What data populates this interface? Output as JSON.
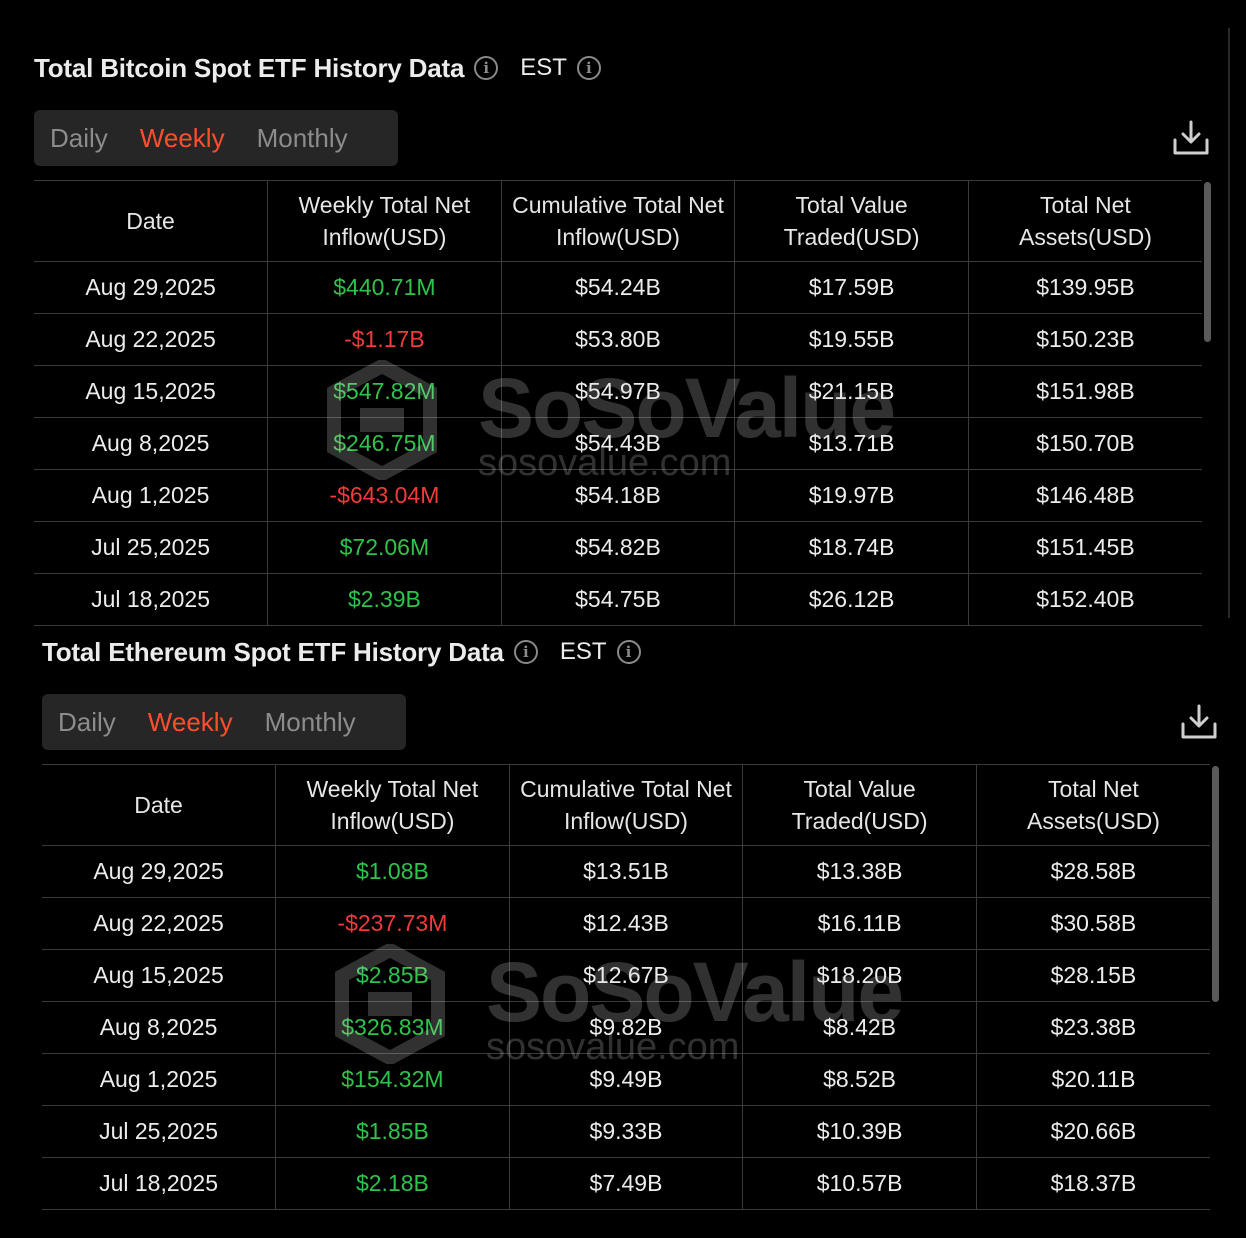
{
  "bitcoin": {
    "title": "Total Bitcoin Spot ETF History Data",
    "timezone": "EST",
    "tabs": [
      "Daily",
      "Weekly",
      "Monthly"
    ],
    "active_tab": "Weekly",
    "headers": [
      "Date",
      "Weekly Total Net Inflow(USD)",
      "Cumulative Total Net Inflow(USD)",
      "Total Value Traded(USD)",
      "Total Net Assets(USD)"
    ],
    "rows": [
      [
        "Aug 29,2025",
        "$440.71M",
        "$54.24B",
        "$17.59B",
        "$139.95B"
      ],
      [
        "Aug 22,2025",
        "-$1.17B",
        "$53.80B",
        "$19.55B",
        "$150.23B"
      ],
      [
        "Aug 15,2025",
        "$547.82M",
        "$54.97B",
        "$21.15B",
        "$151.98B"
      ],
      [
        "Aug 8,2025",
        "$246.75M",
        "$54.43B",
        "$13.71B",
        "$150.70B"
      ],
      [
        "Aug 1,2025",
        "-$643.04M",
        "$54.18B",
        "$19.97B",
        "$146.48B"
      ],
      [
        "Jul 25,2025",
        "$72.06M",
        "$54.82B",
        "$18.74B",
        "$151.45B"
      ],
      [
        "Jul 18,2025",
        "$2.39B",
        "$54.75B",
        "$26.12B",
        "$152.40B"
      ]
    ]
  },
  "ethereum": {
    "title": "Total Ethereum Spot ETF History Data",
    "timezone": "EST",
    "tabs": [
      "Daily",
      "Weekly",
      "Monthly"
    ],
    "active_tab": "Weekly",
    "headers": [
      "Date",
      "Weekly Total Net Inflow(USD)",
      "Cumulative Total Net Inflow(USD)",
      "Total Value Traded(USD)",
      "Total Net Assets(USD)"
    ],
    "rows": [
      [
        "Aug 29,2025",
        "$1.08B",
        "$13.51B",
        "$13.38B",
        "$28.58B"
      ],
      [
        "Aug 22,2025",
        "-$237.73M",
        "$12.43B",
        "$16.11B",
        "$30.58B"
      ],
      [
        "Aug 15,2025",
        "$2.85B",
        "$12.67B",
        "$18.20B",
        "$28.15B"
      ],
      [
        "Aug 8,2025",
        "$326.83M",
        "$9.82B",
        "$8.42B",
        "$23.38B"
      ],
      [
        "Aug 1,2025",
        "$154.32M",
        "$9.49B",
        "$8.52B",
        "$20.11B"
      ],
      [
        "Jul 25,2025",
        "$1.85B",
        "$9.33B",
        "$10.39B",
        "$20.66B"
      ],
      [
        "Jul 18,2025",
        "$2.18B",
        "$7.49B",
        "$10.57B",
        "$18.37B"
      ]
    ]
  },
  "watermark": {
    "name": "SoSoValue",
    "url": "sosovalue.com"
  },
  "colors": {
    "positive": "#2fc34b",
    "negative": "#f23a3a",
    "active_tab": "#ff4d2e",
    "background": "#000000"
  },
  "icons": {
    "info": "info-circle-icon",
    "download": "download-icon",
    "logo": "sosovalue-logo-icon"
  }
}
